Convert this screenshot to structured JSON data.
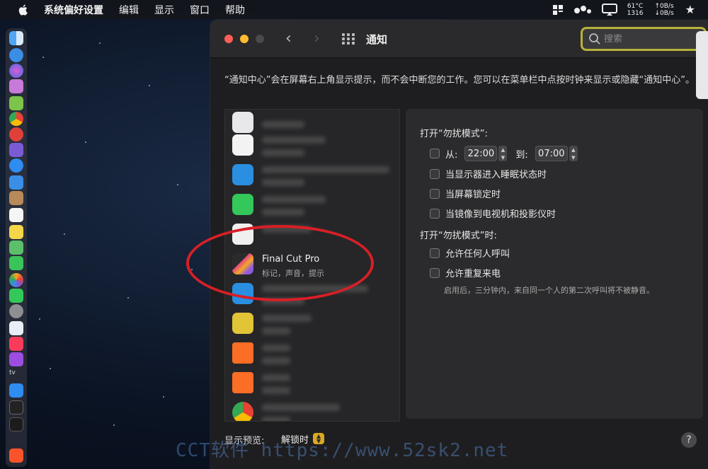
{
  "menubar": {
    "app_name": "系统偏好设置",
    "menus": [
      "编辑",
      "显示",
      "窗口",
      "帮助"
    ],
    "temp": "61°C",
    "rpm": "1316",
    "net_up": "↑0B/s",
    "net_down": "↓0B/s"
  },
  "window": {
    "title": "通知",
    "search_placeholder": "搜索",
    "description": "“通知中心”会在屏幕右上角显示提示，而不会中断您的工作。您可以在菜单栏中点按时钟来显示或隐藏“通知中心”。"
  },
  "app_list": {
    "selected": {
      "name": "Final Cut Pro",
      "subtitle": "标记，声音，提示"
    }
  },
  "dnd": {
    "header1": "打开“勿扰模式”:",
    "from_label": "从:",
    "from_time": "22:00",
    "to_label": "到:",
    "to_time": "07:00",
    "opt_sleep": "当显示器进入睡眠状态时",
    "opt_lock": "当屏幕锁定时",
    "opt_mirror": "当镜像到电视机和投影仪时",
    "header2": "打开“勿扰模式”时:",
    "allow_any": "允许任何人呼叫",
    "allow_repeat": "允许重复来电",
    "repeat_hint": "启用后，三分钟内，来自同一个人的第二次呼叫将不被静音。"
  },
  "footer": {
    "preview_label": "显示预览:",
    "preview_value": "解锁时",
    "help": "?"
  },
  "dock": {
    "tv_label": "tv"
  },
  "watermark": "CCT软件 https://www.52sk2.net",
  "colors": {
    "accent_search": "#b7b23a",
    "annotation_red": "#d81f26",
    "traffic_close": "#ff5f57",
    "traffic_min": "#febc2e",
    "traffic_max": "#3a3a3c"
  }
}
